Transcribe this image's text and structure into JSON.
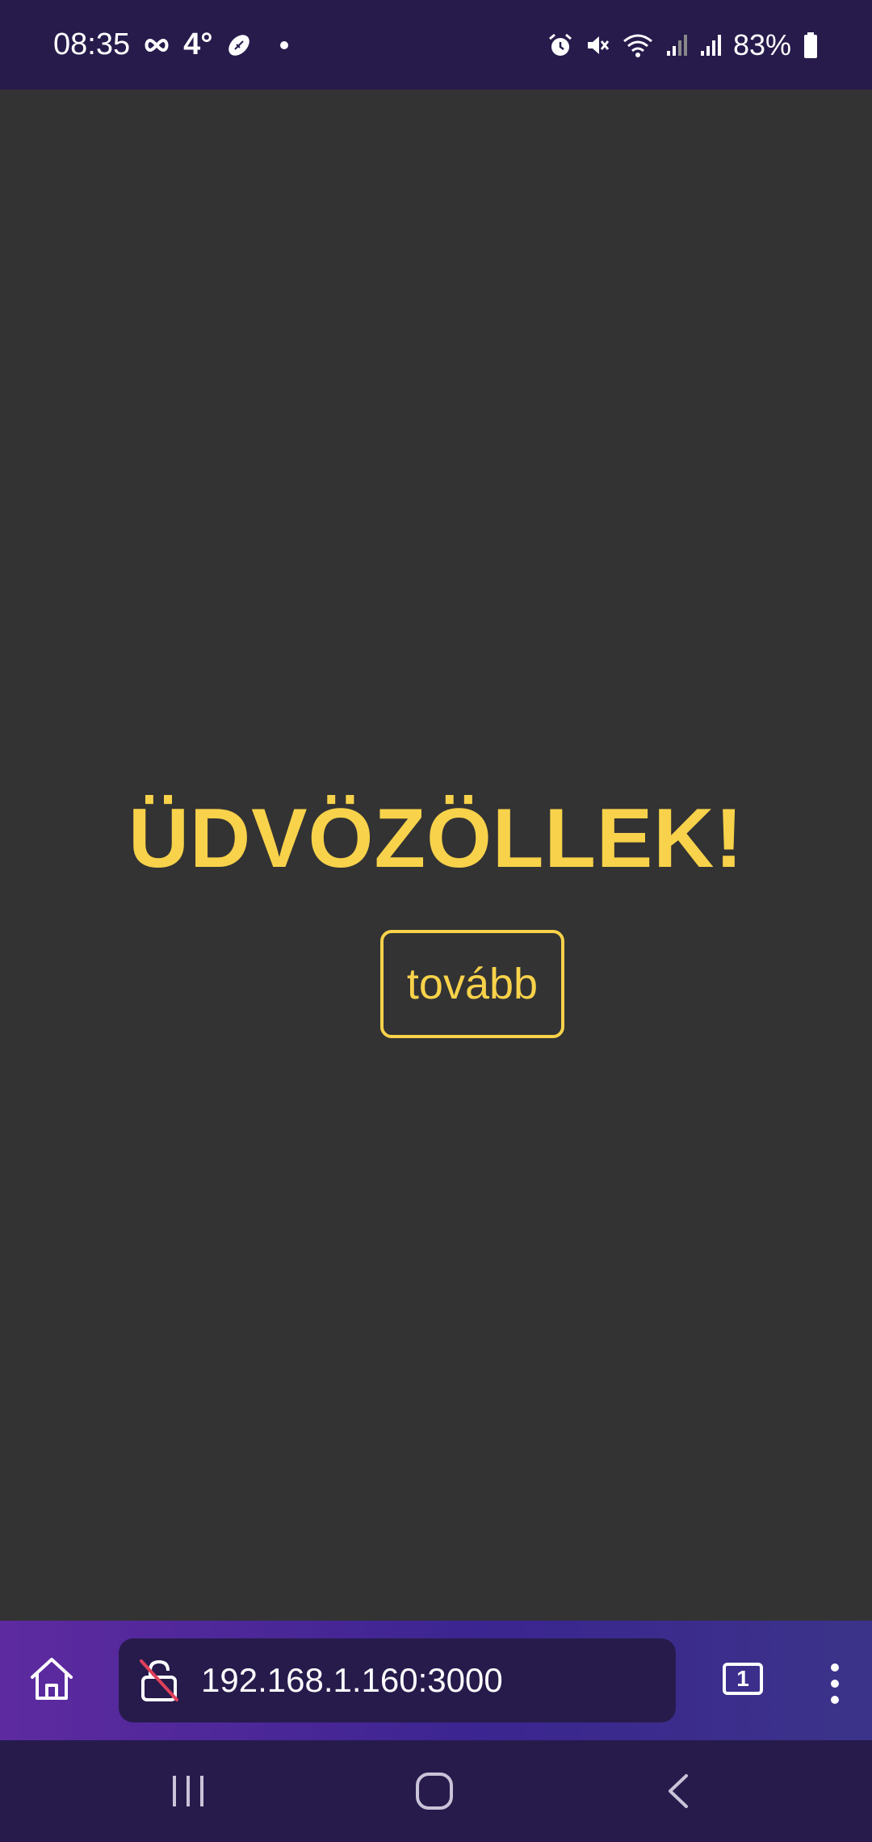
{
  "status_bar": {
    "time": "08:35",
    "temperature": "4°",
    "battery_percent": "83%",
    "icons": [
      "infinity-icon",
      "football-icon",
      "notification-dot-icon",
      "alarm-icon",
      "mute-icon",
      "wifi-icon",
      "signal-icon",
      "signal-icon",
      "battery-icon"
    ]
  },
  "page": {
    "welcome_text": "ÜDVÖZÖLLEK!",
    "next_button_label": "tovább",
    "accent_color": "#f8d24a",
    "background_color": "#333333"
  },
  "browser": {
    "url": "192.168.1.160:3000",
    "tab_count": "1"
  }
}
